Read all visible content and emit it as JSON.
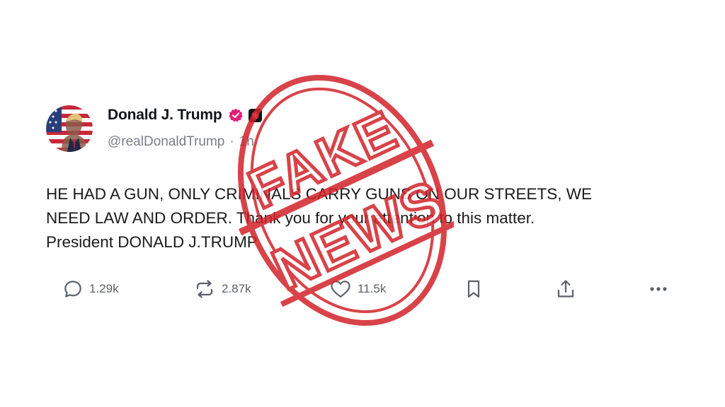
{
  "post": {
    "author": {
      "display_name": "Donald J. Trump",
      "handle": "@realDonaldTrump",
      "time_ago": "1h",
      "separator": "·"
    },
    "avatar_icon": "flag-portrait-avatar",
    "badges": [
      "verified-badge-icon",
      "brand-badge-icon"
    ],
    "body_lines": [
      "HE HAD A GUN, ONLY CRIMINALS CARRY GUNS ON OUR STREETS, WE",
      "NEED LAW AND ORDER. Thank you for your attention to this matter.",
      "President DONALD J.TRUMP"
    ],
    "actions": {
      "reply_count": "1.29k",
      "retruth_count": "2.87k",
      "like_count": "11.5k"
    }
  },
  "stamp": {
    "line1": "FAKE",
    "line2": "NEWS",
    "color": "#d2232a"
  },
  "colors": {
    "text": "#0f1419",
    "muted": "#7a7f85",
    "verified": "#e11d74"
  }
}
